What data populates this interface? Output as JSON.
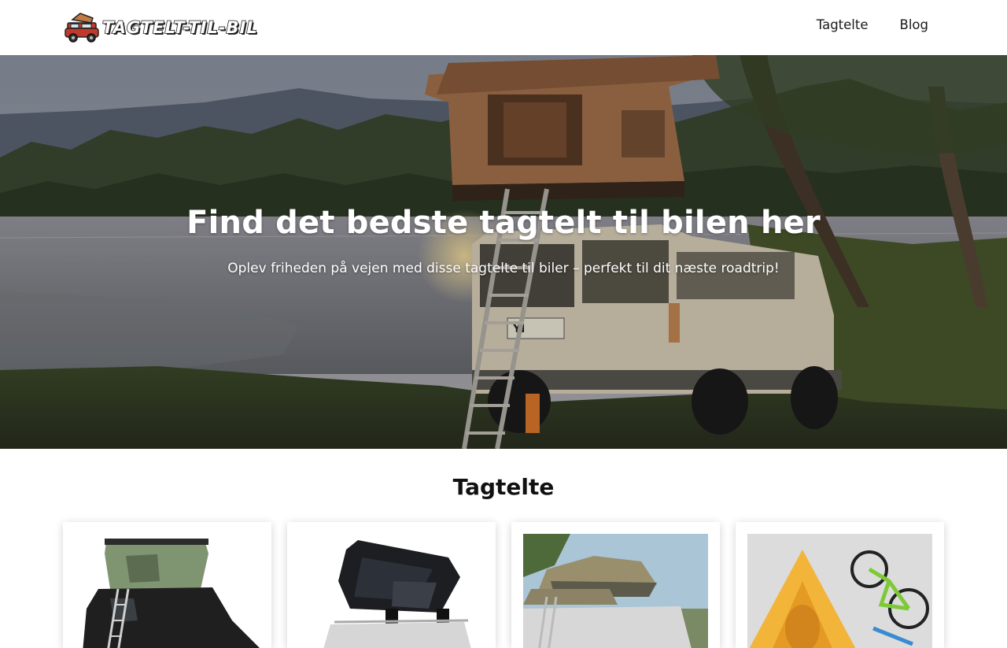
{
  "header": {
    "logo_text": "TAGTELT-TIL-BIL",
    "nav": [
      {
        "label": "Tagtelte"
      },
      {
        "label": "Blog"
      }
    ]
  },
  "hero": {
    "title": "Find det bedste tagtelt til bilen her",
    "subtitle": "Oplev friheden på vejen med disse tagtelte til biler – perfekt til dit næste roadtrip!",
    "plate_text": "YI"
  },
  "products": {
    "heading": "Tagtelte",
    "cards": [
      {
        "image": "green-hardshell-rooftop-tent-on-black-suv"
      },
      {
        "image": "black-hardshell-rooftop-tent-on-white-car"
      },
      {
        "image": "khaki-softshell-rooftop-tent-on-car"
      },
      {
        "image": "yellow-rooftop-tent-with-bicycles"
      }
    ]
  },
  "colors": {
    "header_bg": "#ffffff",
    "hero_overlay": "rgba(0,0,0,0.18)",
    "tent": "#a8754f",
    "car": "#e6dcc4"
  }
}
